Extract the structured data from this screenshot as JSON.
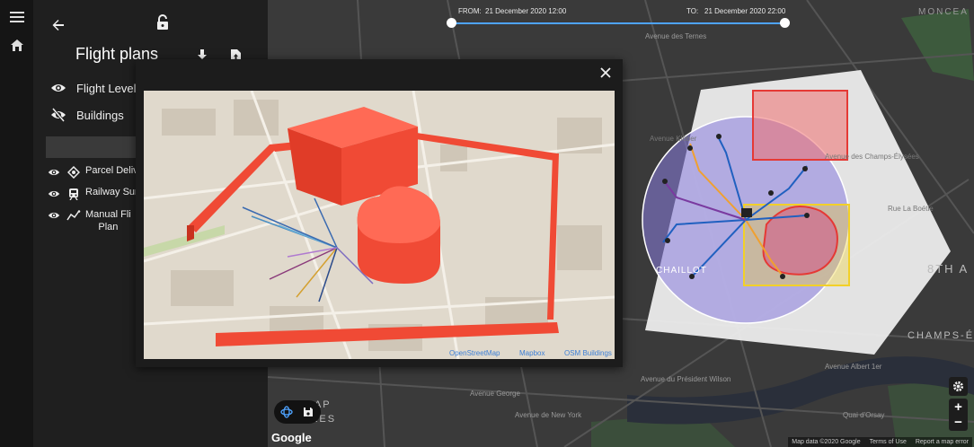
{
  "sidebar": {
    "menu_icon": "menu-icon",
    "home_icon": "home-icon"
  },
  "panel": {
    "back_icon": "arrow-back-icon",
    "lock_icon": "lock-open-icon",
    "title": "Flight plans",
    "download_icon": "download-icon",
    "upload_icon": "file-upload-icon",
    "toggles": [
      {
        "label": "Flight Levels",
        "icon": "eye-icon"
      },
      {
        "label": "Buildings",
        "icon": "eye-off-icon"
      }
    ],
    "plans": [
      {
        "label": "Parcel Delive",
        "icon": "drone-icon"
      },
      {
        "label": "Railway Surv",
        "icon": "train-icon"
      },
      {
        "label": "Manual Fli\nPlan",
        "icon": "manual-route-icon"
      }
    ]
  },
  "timebar": {
    "from_label": "FROM:",
    "from_value": "21 December 2020 12:00",
    "to_label": "TO:",
    "to_value": "21 December 2020 22:00"
  },
  "modal": {
    "close_icon": "close-icon",
    "attributions": [
      "OpenStreetMap",
      "Mapbox",
      "OSM Buildings"
    ]
  },
  "map": {
    "labels": [
      "MONCEA",
      "CHAILLOT",
      "8TH A",
      "CHAMPS-ÉLYSÉE",
      "NAP",
      "UBLES",
      "Avenue George",
      "Avenue de New York",
      "Avenue Albert 1er",
      "Avenue des Champs-Élysées",
      "Avenue du Président Wilson",
      "Rue La Boétie",
      "Quai d'Orsay",
      "Avenue Kléber",
      "Avenue des Ternes"
    ],
    "google": "Google",
    "footer": [
      "Map data ©2020 Google",
      "Terms of Use",
      "Report a map error"
    ],
    "colors": {
      "zone_red": "#e53935",
      "zone_yellow": "#f2d028",
      "zone_purple": "#7b6cd9",
      "timeline": "#4ea3ff"
    }
  },
  "tools": {
    "view3d_icon": "3d-rotation-icon",
    "save_icon": "save-icon",
    "settings_icon": "gear-icon",
    "zoom_in_label": "+",
    "zoom_out_label": "−"
  }
}
